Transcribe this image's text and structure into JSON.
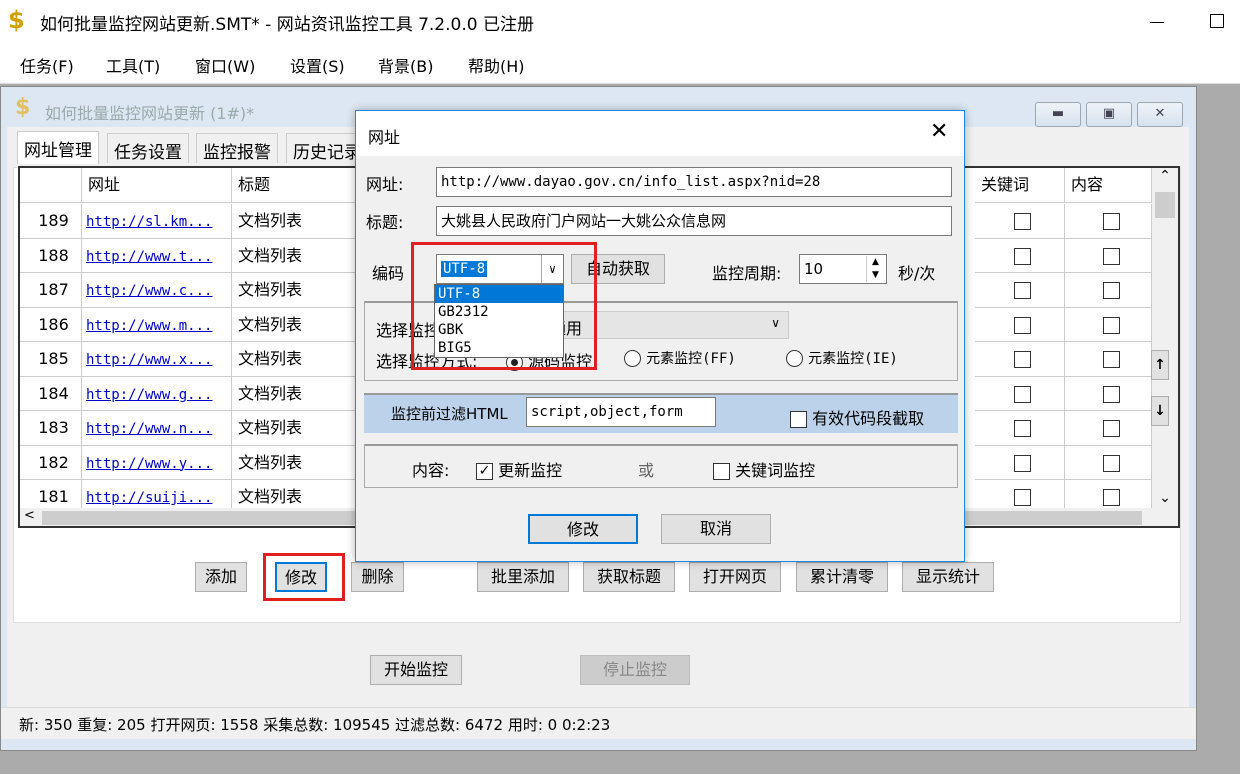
{
  "app": {
    "title": "如何批量监控网站更新.SMT* - 网站资讯监控工具 7.2.0.0 已注册",
    "icon": "dollar-icon"
  },
  "menu": [
    "任务(F)",
    "工具(T)",
    "窗口(W)",
    "设置(S)",
    "背景(B)",
    "帮助(H)"
  ],
  "child": {
    "title": "如何批量监控网站更新  (1#)*",
    "tabs": [
      "网址管理",
      "任务设置",
      "监控报警",
      "历史记录"
    ]
  },
  "grid": {
    "headers": {
      "url": "网址",
      "title": "标题",
      "keyword": "关键词",
      "content": "内容"
    },
    "rows": [
      {
        "id": "189",
        "url": "http://sl.km...",
        "title": "文档列表"
      },
      {
        "id": "188",
        "url": "http://www.t...",
        "title": "文档列表"
      },
      {
        "id": "187",
        "url": "http://www.c...",
        "title": "文档列表"
      },
      {
        "id": "186",
        "url": "http://www.m...",
        "title": "文档列表"
      },
      {
        "id": "185",
        "url": "http://www.x...",
        "title": "文档列表"
      },
      {
        "id": "184",
        "url": "http://www.g...",
        "title": "文档列表"
      },
      {
        "id": "183",
        "url": "http://www.n...",
        "title": "文档列表"
      },
      {
        "id": "182",
        "url": "http://www.y...",
        "title": "文档列表"
      },
      {
        "id": "181",
        "url": "http://suiji...",
        "title": "文档列表"
      }
    ]
  },
  "buttons": {
    "add": "添加",
    "edit": "修改",
    "delete": "删除",
    "batch_add": "批里添加",
    "get_title": "获取标题",
    "open_page": "打开网页",
    "reset": "累计清零",
    "show_stats": "显示统计",
    "start": "开始监控",
    "stop": "停止监控"
  },
  "status": "新: 350  重复: 205  打开网页: 1558  采集总数: 109545  过滤总数: 6472  用时: 0 0:2:23",
  "dialog": {
    "title": "网址",
    "url_label": "网址:",
    "url": "http://www.dayao.gov.cn/info_list.aspx?nid=28",
    "title_label": "标题:",
    "title_value": "大姚县人民政府门户网站一大姚公众信息网",
    "encoding_label": "编码",
    "encoding": "UTF-8",
    "encoding_options": [
      "UTF-8",
      "GB2312",
      "GBK",
      "BIG5"
    ],
    "auto_detect": "自动获取",
    "period_label": "监控周期:",
    "period": "10",
    "period_unit": "秒/次",
    "template_label": "选择监控模板:",
    "template": "通用",
    "mode_label": "选择监控方式:",
    "modes": [
      "源码监控",
      "元素监控(FF)",
      "元素监控(IE)"
    ],
    "filter_label": "监控前过滤HTML",
    "filter": "script,object,form",
    "snippet": "有效代码段截取",
    "content_label": "内容:",
    "update_monitor": "更新监控",
    "or": "或",
    "keyword_monitor": "关键词监控",
    "ok": "修改",
    "cancel": "取消"
  }
}
